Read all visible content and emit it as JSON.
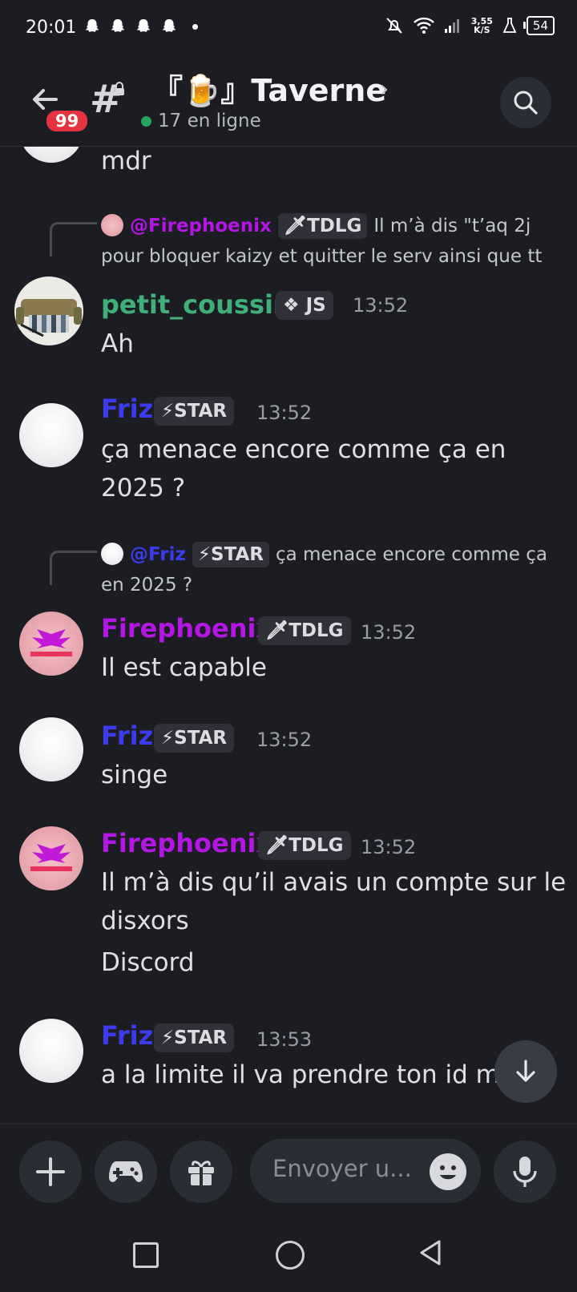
{
  "status_bar": {
    "time": "20:01",
    "speed_value": "3,55",
    "speed_unit": "K/S",
    "battery": "54"
  },
  "header": {
    "unread_badge": "99",
    "channel_name": "『🍺』Taverne",
    "online": "17 en ligne"
  },
  "messages": [
    {
      "id": "m0",
      "text": "mdr"
    },
    {
      "id": "m1",
      "reply": {
        "author": "@Firephoenix",
        "tag": "🗡TDLG",
        "text": "Il m’à dis \"t’aq 2j",
        "text2": "pour bloquer kaizy et quitter le serv ainsi que tt"
      },
      "author": "petit_coussin",
      "tag": "❖ JS",
      "time": "13:52",
      "lines": [
        "Ah"
      ]
    },
    {
      "id": "m2",
      "author": "Friz",
      "tag": "⚡STAR",
      "time": "13:52",
      "lines": [
        "ça menace encore comme ça en",
        "2025 ?"
      ]
    },
    {
      "id": "m3",
      "reply": {
        "author": "@Friz",
        "tag": "⚡STAR",
        "text": "ça menace encore comme ça",
        "text2": "en 2025 ?"
      },
      "author": "Firephoenix",
      "tag": "🗡TDLG",
      "time": "13:52",
      "lines": [
        "Il est capable"
      ]
    },
    {
      "id": "m4",
      "author": "Friz",
      "tag": "⚡STAR",
      "time": "13:52",
      "lines": [
        "singe"
      ]
    },
    {
      "id": "m5",
      "author": "Firephoenix",
      "tag": "🗡TDLG",
      "time": "13:52",
      "lines": [
        "Il m’à dis qu’il avais un compte sur le",
        "disxors",
        "Discord"
      ]
    },
    {
      "id": "m6",
      "author": "Friz",
      "tag": "⚡STAR",
      "time": "13:53",
      "lines": [
        "a la limite il va prendre ton id mais il"
      ]
    }
  ],
  "composer": {
    "placeholder": "Envoyer u..."
  },
  "colors": {
    "friz": "#3b3bf0",
    "firephoenix": "#b416e6",
    "coussin": "#3fb07a",
    "accent_badge": "#e5343f",
    "online": "#23a55a"
  },
  "icons": [
    "back-arrow-icon",
    "hash-lock-icon",
    "search-icon",
    "plus-icon",
    "gamepad-icon",
    "gift-icon",
    "emoji-icon",
    "mic-icon",
    "arrow-down-icon"
  ]
}
